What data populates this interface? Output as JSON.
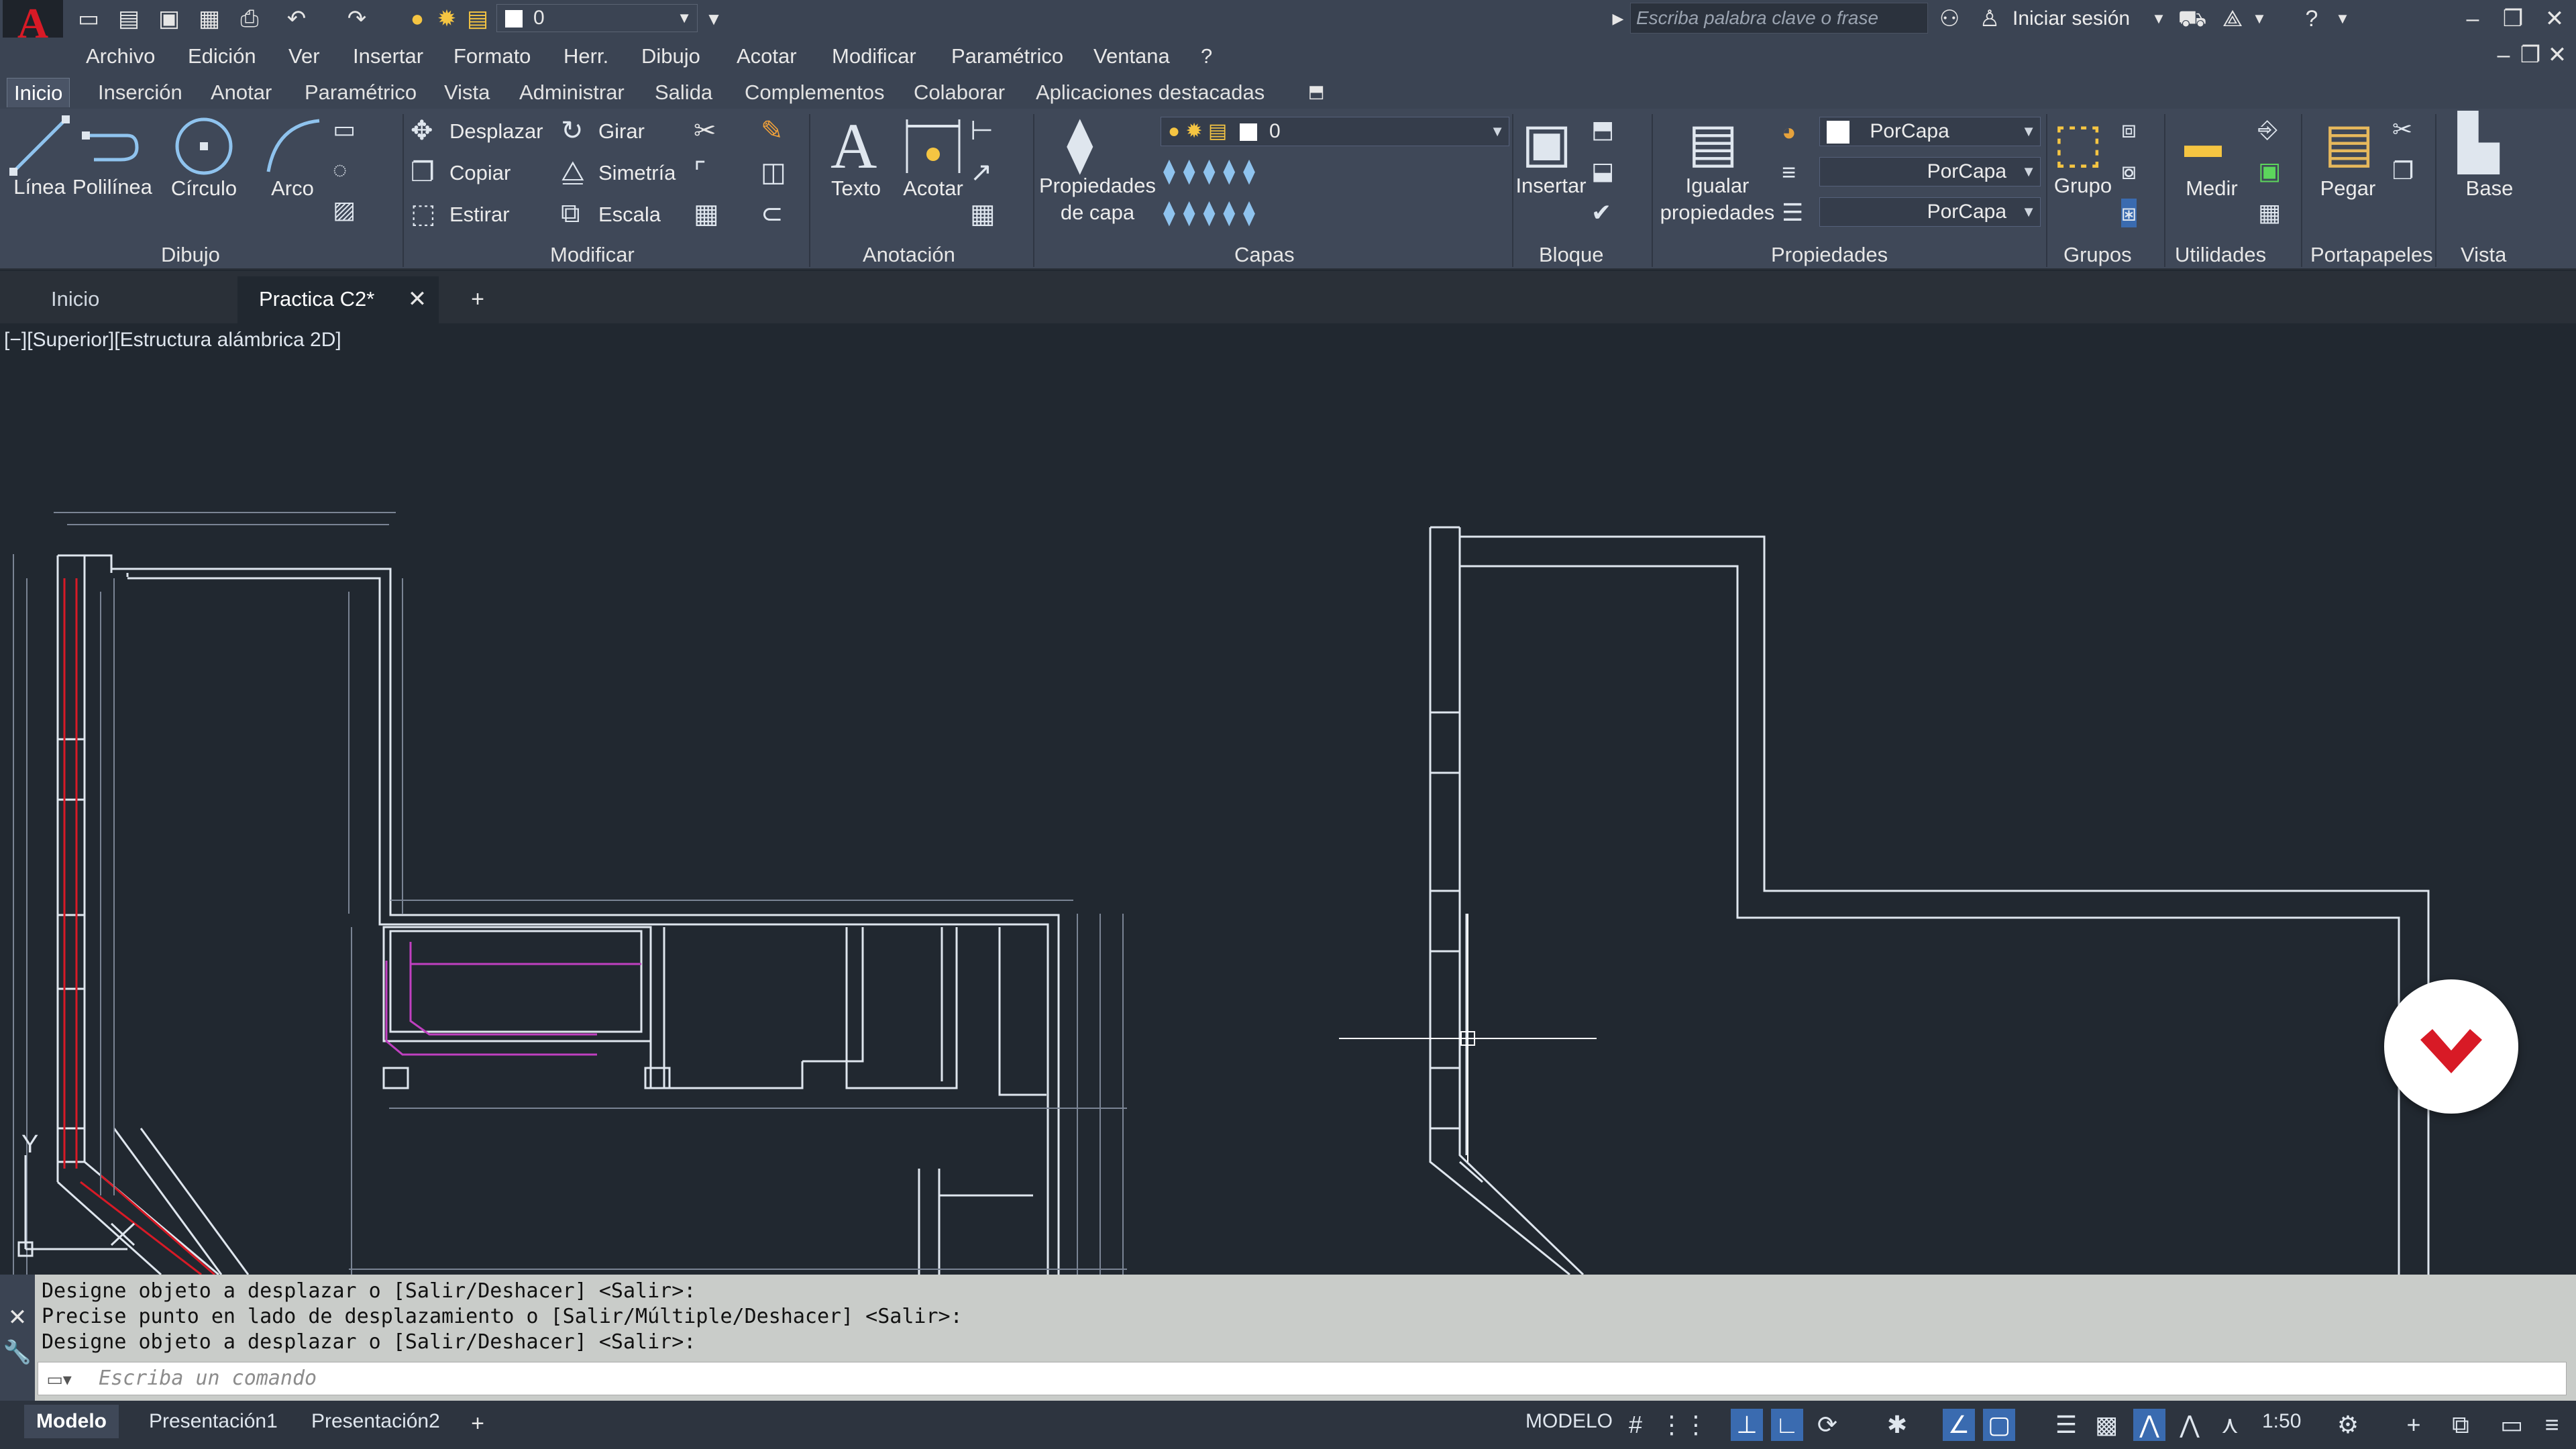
{
  "app": {
    "logo_letter": "A",
    "layer_value": "0",
    "search_placeholder": "Escriba palabra clave o frase",
    "signin": "Iniciar sesión"
  },
  "menubar": {
    "items": [
      "Archivo",
      "Edición",
      "Ver",
      "Insertar",
      "Formato",
      "Herr.",
      "Dibujo",
      "Acotar",
      "Modificar",
      "Paramétrico",
      "Ventana",
      "?"
    ]
  },
  "ribbon_tabs": {
    "items": [
      "Inicio",
      "Inserción",
      "Anotar",
      "Paramétrico",
      "Vista",
      "Administrar",
      "Salida",
      "Complementos",
      "Colaborar",
      "Aplicaciones destacadas"
    ],
    "active": "Inicio"
  },
  "ribbon": {
    "draw": {
      "line": "Línea",
      "polyline": "Polilínea",
      "circle": "Círculo",
      "arc": "Arco",
      "title": "Dibujo"
    },
    "modify": {
      "move": "Desplazar",
      "rotate": "Girar",
      "copy": "Copiar",
      "mirror": "Simetría",
      "stretch": "Estirar",
      "scale": "Escala",
      "title": "Modificar"
    },
    "annotation": {
      "text": "Texto",
      "dimension": "Acotar",
      "title": "Anotación"
    },
    "layers": {
      "properties_line1": "Propiedades",
      "properties_line2": "de capa",
      "layer_value": "0",
      "title": "Capas"
    },
    "block": {
      "insert": "Insertar",
      "title": "Bloque"
    },
    "properties": {
      "match_line1": "Igualar",
      "match_line2": "propiedades",
      "color": "PorCapa",
      "linetype": "PorCapa",
      "lineweight": "PorCapa",
      "title": "Propiedades"
    },
    "groups": {
      "group": "Grupo",
      "title": "Grupos"
    },
    "utilities": {
      "measure": "Medir",
      "title": "Utilidades"
    },
    "clipboard": {
      "paste": "Pegar",
      "title": "Portapapeles"
    },
    "view": {
      "base": "Base",
      "title": "Vista"
    }
  },
  "file_tabs": {
    "items": [
      "Inicio",
      "Practica C2*"
    ],
    "active": "Practica C2*"
  },
  "viewport": {
    "label": "[−][Superior][Estructura alámbrica 2D]",
    "ucs_y": "Y"
  },
  "command": {
    "history": [
      "Designe objeto a desplazar o [Salir/Deshacer] <Salir>:",
      "Precise punto en lado de desplazamiento o [Salir/Múltiple/Deshacer] <Salir>:",
      "Designe objeto a desplazar o [Salir/Deshacer] <Salir>:"
    ],
    "placeholder": "Escriba un comando"
  },
  "status": {
    "layout_tabs": [
      "Modelo",
      "Presentación1",
      "Presentación2"
    ],
    "active_layout": "Modelo",
    "mode": "MODELO",
    "scale": "1:50"
  },
  "colors": {
    "titlebar": "#3b4453",
    "ribbon": "#3f4858",
    "canvas": "#212830",
    "command_bg": "#c9ccc9",
    "accent_red": "#d81a26"
  }
}
